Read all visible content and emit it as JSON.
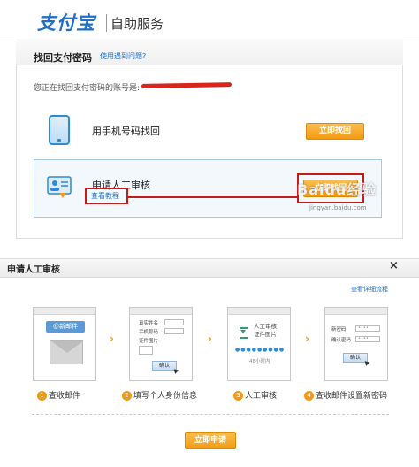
{
  "header": {
    "logo": "支付宝",
    "service": "自助服务"
  },
  "panel": {
    "title": "找回支付密码",
    "help_link": "使用遇到问题?",
    "account_prompt": "您正在找回支付密码的账号是:",
    "option_phone": {
      "label": "用手机号码找回",
      "button": "立即找回"
    },
    "option_manual": {
      "label": "申请人工审核",
      "link": "查看教程",
      "button": "立即找回"
    }
  },
  "watermark": {
    "text": "Baidu经验",
    "url": "jingyan.baidu.com"
  },
  "dialog": {
    "title": "申请人工审核",
    "close": "×",
    "detail_link": "查看详细流程",
    "steps": [
      {
        "num": "1",
        "label": "查收邮件",
        "badge": "@新邮件"
      },
      {
        "num": "2",
        "label": "填写个人身份信息",
        "fields": [
          "真实姓名",
          "手机号码",
          "证件图片"
        ],
        "button": "确认"
      },
      {
        "num": "3",
        "label": "人工审核",
        "text": "人工审核\n证件图片",
        "time": "48小时内"
      },
      {
        "num": "4",
        "label": "查收邮件设置新密码",
        "fields": [
          "新密码",
          "确认密码"
        ],
        "button": "确认"
      }
    ],
    "submit": "立即申请"
  },
  "colors": {
    "brand": "#1f6fc7",
    "accent": "#f29b12",
    "highlight": "#c41b1b"
  }
}
